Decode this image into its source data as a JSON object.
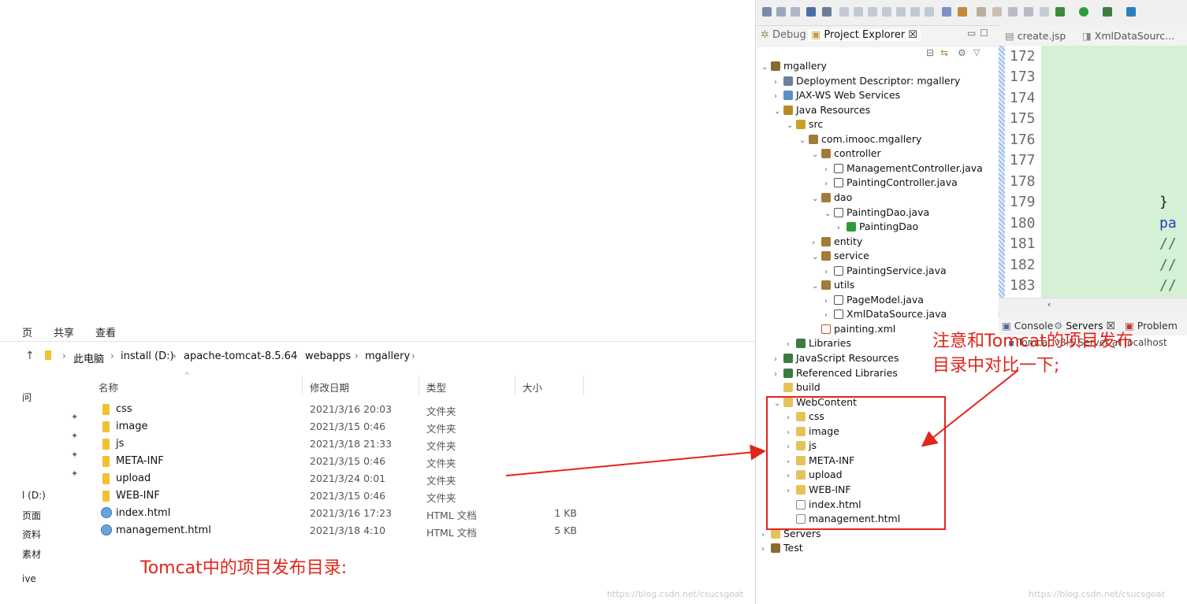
{
  "explorer": {
    "ribbon_tabs": [
      "页",
      "共享",
      "查看"
    ],
    "breadcrumb": [
      "此电脑",
      "install (D:)",
      "apache-tomcat-8.5.64",
      "webapps",
      "mgallery"
    ],
    "columns": {
      "name": "名称",
      "date": "修改日期",
      "type": "类型",
      "size": "大小"
    },
    "left_nav": [
      "问",
      "l (D:)",
      "页面",
      "资料",
      "素材",
      "ive"
    ],
    "files": [
      {
        "name": "css",
        "date": "2021/3/16 20:03",
        "type": "文件夹",
        "size": "",
        "kind": "folder"
      },
      {
        "name": "image",
        "date": "2021/3/15 0:46",
        "type": "文件夹",
        "size": "",
        "kind": "folder"
      },
      {
        "name": "js",
        "date": "2021/3/18 21:33",
        "type": "文件夹",
        "size": "",
        "kind": "folder"
      },
      {
        "name": "META-INF",
        "date": "2021/3/15 0:46",
        "type": "文件夹",
        "size": "",
        "kind": "folder"
      },
      {
        "name": "upload",
        "date": "2021/3/24 0:01",
        "type": "文件夹",
        "size": "",
        "kind": "folder"
      },
      {
        "name": "WEB-INF",
        "date": "2021/3/15 0:46",
        "type": "文件夹",
        "size": "",
        "kind": "folder"
      },
      {
        "name": "index.html",
        "date": "2021/3/16 17:23",
        "type": "HTML 文档",
        "size": "1 KB",
        "kind": "html"
      },
      {
        "name": "management.html",
        "date": "2021/3/18 4:10",
        "type": "HTML 文档",
        "size": "5 KB",
        "kind": "html"
      }
    ],
    "note": "Tomcat中的项目发布目录:",
    "watermark": "https://blog.csdn.net/csucsgoat"
  },
  "eclipse": {
    "tabs": {
      "debug": "Debug",
      "project_explorer": "Project Explorer ☒"
    },
    "tree": [
      {
        "label": "mgallery",
        "tw": "v",
        "icon": "ic-proj"
      },
      {
        "label": "Deployment Descriptor: mgallery",
        "tw": ">",
        "icon": "ic-dd"
      },
      {
        "label": "JAX-WS Web Services",
        "tw": ">",
        "icon": "ic-ws"
      },
      {
        "label": "Java Resources",
        "tw": "v",
        "icon": "ic-jr"
      },
      {
        "label": "src",
        "tw": "v",
        "icon": "ic-src"
      },
      {
        "label": "com.imooc.mgallery",
        "tw": "v",
        "icon": "ic-pkg"
      },
      {
        "label": "controller",
        "tw": "v",
        "icon": "ic-pkg"
      },
      {
        "label": "ManagementController.java",
        "tw": ">",
        "icon": "ic-java"
      },
      {
        "label": "PaintingController.java",
        "tw": ">",
        "icon": "ic-java"
      },
      {
        "label": "dao",
        "tw": "v",
        "icon": "ic-pkg"
      },
      {
        "label": "PaintingDao.java",
        "tw": "v",
        "icon": "ic-java"
      },
      {
        "label": "PaintingDao",
        "tw": ">",
        "icon": "ic-cls"
      },
      {
        "label": "entity",
        "tw": ">",
        "icon": "ic-pkg"
      },
      {
        "label": "service",
        "tw": "v",
        "icon": "ic-pkg"
      },
      {
        "label": "PaintingService.java",
        "tw": ">",
        "icon": "ic-java"
      },
      {
        "label": "utils",
        "tw": "v",
        "icon": "ic-pkg"
      },
      {
        "label": "PageModel.java",
        "tw": ">",
        "icon": "ic-java"
      },
      {
        "label": "XmlDataSource.java",
        "tw": ">",
        "icon": "ic-java"
      },
      {
        "label": "painting.xml",
        "tw": "",
        "icon": "ic-xml"
      },
      {
        "label": "Libraries",
        "tw": ">",
        "icon": "ic-lib"
      },
      {
        "label": "JavaScript Resources",
        "tw": ">",
        "icon": "ic-lib"
      },
      {
        "label": "Referenced Libraries",
        "tw": ">",
        "icon": "ic-lib"
      },
      {
        "label": "build",
        "tw": "",
        "icon": "ic-fold"
      },
      {
        "label": "WebContent",
        "tw": "v",
        "icon": "ic-fold"
      },
      {
        "label": "css",
        "tw": ">",
        "icon": "ic-fold"
      },
      {
        "label": "image",
        "tw": ">",
        "icon": "ic-fold"
      },
      {
        "label": "js",
        "tw": ">",
        "icon": "ic-fold"
      },
      {
        "label": "META-INF",
        "tw": ">",
        "icon": "ic-fold"
      },
      {
        "label": "upload",
        "tw": ">",
        "icon": "ic-fold"
      },
      {
        "label": "WEB-INF",
        "tw": ">",
        "icon": "ic-fold"
      },
      {
        "label": "index.html",
        "tw": "",
        "icon": "ic-file"
      },
      {
        "label": "management.html",
        "tw": "",
        "icon": "ic-file"
      },
      {
        "label": "Servers",
        "tw": ">",
        "icon": "ic-fold"
      },
      {
        "label": "Test",
        "tw": ">",
        "icon": "ic-proj"
      }
    ],
    "editor_tabs": [
      "create.jsp",
      "XmlDataSourc..."
    ],
    "line_numbers": [
      "172",
      "173",
      "174",
      "175",
      "176",
      "177",
      "178",
      "179",
      "180",
      "181",
      "182",
      "183"
    ],
    "code": {
      "l179": "}",
      "l180": "pa",
      "l181": "//",
      "l182": "//",
      "l183": "//"
    },
    "bottom_tabs": [
      "Console",
      "Servers ☒",
      "Problem"
    ],
    "server_row": "Tomcat v8.5 Server at localhost",
    "note_line1": "注意和Tomcat的项目发布",
    "note_line2": "目录中对比一下;",
    "watermark": "https://blog.csdn.net/csucsgoat"
  }
}
